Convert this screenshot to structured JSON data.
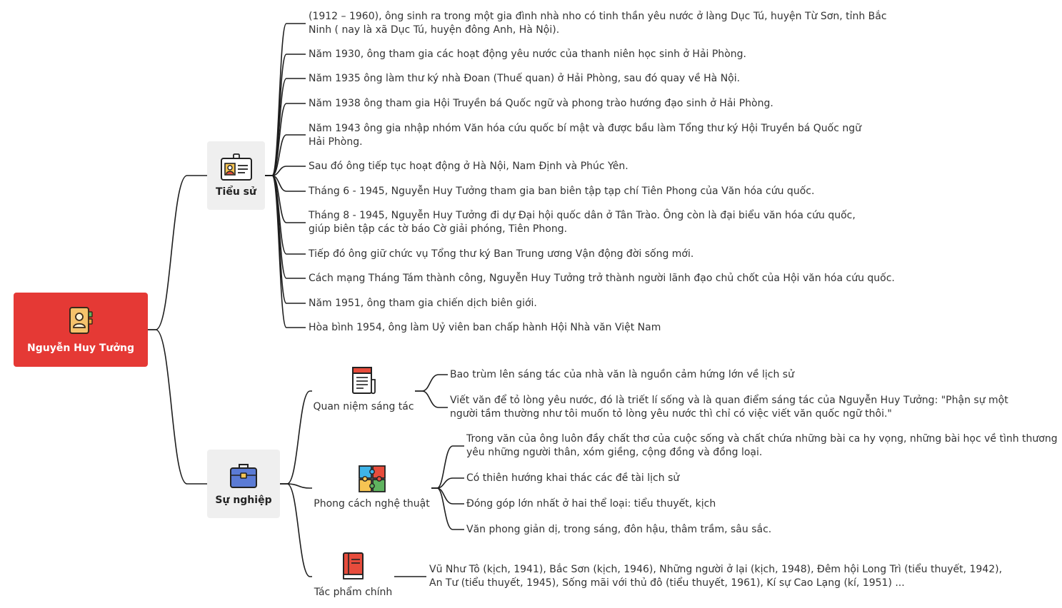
{
  "root": {
    "label": "Nguyễn Huy Tưởng",
    "icon": "notebook-user-icon"
  },
  "branches": {
    "tieu_su": {
      "label": "Tiểu sử",
      "icon": "id-badge-icon",
      "items": [
        "(1912 – 1960), ông sinh ra trong một gia đình nhà nho có tinh thần yêu nước ở làng Dục Tú, huyện Từ Sơn, tỉnh Bắc Ninh ( nay là xã Dục Tú, huyện đông Anh, Hà Nội).",
        "Năm 1930, ông tham gia các hoạt động yêu nước của thanh niên học sinh ở Hải Phòng.",
        "Năm 1935 ông làm thư ký nhà Đoan (Thuế quan) ở Hải Phòng, sau đó quay về Hà Nội.",
        "Năm 1938 ông tham gia Hội Truyền bá Quốc ngữ và phong trào hướng đạo sinh ở Hải Phòng.",
        "Năm 1943 ông gia nhập nhóm Văn hóa cứu quốc bí mật và được bầu làm Tổng thư ký Hội Truyền bá Quốc ngữ Hải Phòng.",
        "Sau đó ông tiếp tục hoạt động ở Hà Nội, Nam Định và Phúc Yên.",
        "Tháng 6 - 1945, Nguyễn Huy Tưởng tham gia ban biên tập tạp chí Tiên Phong của Văn hóa cứu quốc.",
        "Tháng 8 - 1945, Nguyễn Huy Tưởng đi dự Đại hội quốc dân ở Tân Trào. Ông còn là đại biểu văn hóa cứu quốc, giúp biên tập các tờ báo Cờ giải phóng, Tiên Phong.",
        "Tiếp đó ông giữ chức vụ Tổng thư ký Ban Trung ương Vận động đời sống mới.",
        "Cách mạng Tháng Tám thành công, Nguyễn Huy Tưởng trở thành người lãnh đạo chủ chốt của Hội văn hóa cứu quốc.",
        "Năm 1951, ông tham gia chiến dịch biên giới.",
        "Hòa bình 1954, ông làm Uỷ viên ban chấp hành Hội Nhà văn Việt Nam"
      ]
    },
    "su_nghiep": {
      "label": "Sự nghiệp",
      "icon": "briefcase-icon",
      "subs": {
        "quan_niem": {
          "label": "Quan niệm sáng tác",
          "icon": "document-icon",
          "items": [
            "Bao trùm lên sáng tác của nhà văn là nguồn cảm hứng lớn về lịch sử",
            "Viết văn để tỏ lòng yêu nước, đó là triết lí sống và là quan điểm sáng tác của Nguyễn Huy Tưởng: \"Phận sự một người tầm thường như tôi muốn tỏ lòng yêu nước thì chỉ có việc viết văn quốc ngữ thôi.\""
          ]
        },
        "phong_cach": {
          "label": "Phong cách nghệ thuật",
          "icon": "puzzle-icon",
          "items": [
            "Trong văn của ông luôn đầy chất thơ của cuộc sống và chất chứa những bài ca hy vọng, những bài học về tình thương yêu những người thân, xóm giềng, cộng đồng và đồng loại.",
            "Có thiên hướng khai thác các đề tài lịch sử",
            "Đóng góp lớn nhất ở hai thể loại: tiểu thuyết, kịch",
            "Văn phong giản dị, trong sáng, đôn hậu, thâm trầm, sâu sắc."
          ]
        },
        "tac_pham": {
          "label": "Tác phẩm chính",
          "icon": "book-icon",
          "items": [
            "Vũ Như Tô (kịch, 1941), Bắc Sơn (kịch, 1946), Những người ở lại (kịch, 1948), Đêm hội Long Trì (tiểu thuyết, 1942), An Tư (tiểu thuyết, 1945), Sống mãi với thủ đô (tiểu thuyết, 1961), Kí sự Cao Lạng (kí, 1951) ..."
          ]
        }
      }
    }
  },
  "colors": {
    "root_bg": "#e53935",
    "branch_bg": "#efefef",
    "line": "#1e1e1e"
  }
}
